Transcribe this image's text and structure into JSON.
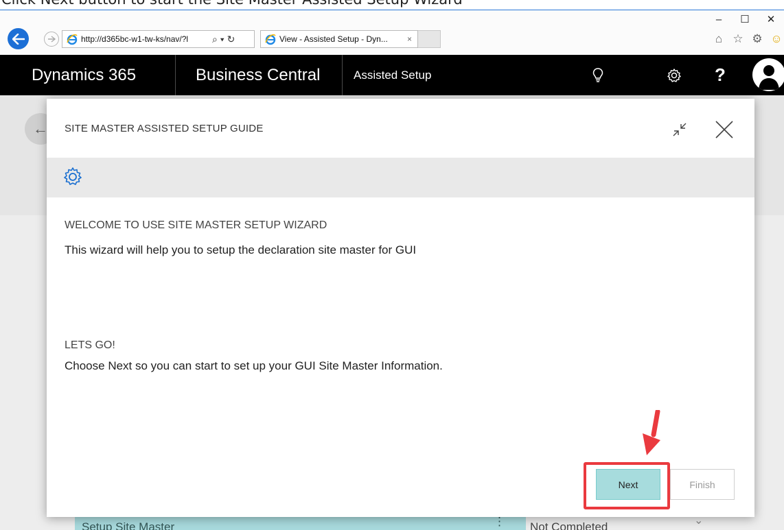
{
  "caption": "Click Next button to start the Site Master Assisted Setup Wizard",
  "browser": {
    "url": "http://d365bc-w1-tw-ks/nav/?l",
    "search_glyph": "⌕ ▾",
    "refresh_glyph": "↻",
    "tab_title": "View - Assisted Setup - Dyn...",
    "tab_close": "×",
    "window_controls": [
      "–",
      "☐",
      "✕"
    ],
    "right_icons": [
      "⌂",
      "☆",
      "⚙",
      "☺"
    ]
  },
  "header": {
    "product": "Dynamics 365",
    "app": "Business Central",
    "page": "Assisted Setup",
    "help": "?"
  },
  "background": {
    "row_label": "Setup Site Master",
    "row_menu": "⋮",
    "status": "Not Completed",
    "chevron": "⌄"
  },
  "dialog": {
    "title": "SITE MASTER ASSISTED SETUP GUIDE",
    "heading1": "WELCOME TO USE SITE MASTER SETUP WIZARD",
    "text1": "This wizard will help you to setup the declaration site master for GUI",
    "heading2": "LETS GO!",
    "text2": "Choose Next so you can start to set up your GUI Site Master Information.",
    "next_label": "Next",
    "finish_label": "Finish"
  },
  "colors": {
    "accent": "#1c6fd6",
    "header_bg": "#000000",
    "next_bg": "#a7dcdd",
    "annotation": "#ea3a3f"
  }
}
